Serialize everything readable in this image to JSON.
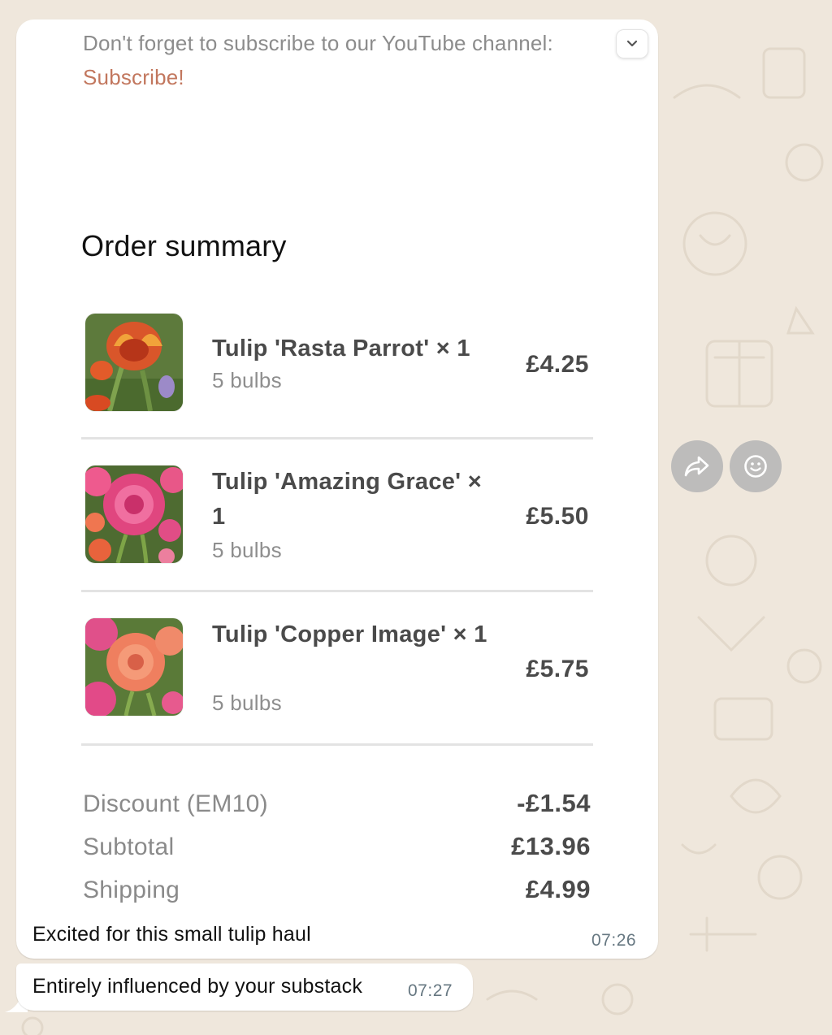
{
  "chat": {
    "message": {
      "preview_text": "Don't forget to subscribe to our YouTube channel:",
      "preview_link": "Subscribe!",
      "order_title": "Order summary",
      "items": [
        {
          "name": "Tulip 'Rasta Parrot' × 1",
          "detail": "5 bulbs",
          "price": "£4.25",
          "image_icon": "tulip-photo-rasta-parrot"
        },
        {
          "name": "Tulip 'Amazing Grace' × 1",
          "detail": "5 bulbs",
          "price": "£5.50",
          "image_icon": "tulip-photo-amazing-grace"
        },
        {
          "name": "Tulip 'Copper Image' × 1",
          "detail": "5 bulbs",
          "price": "£5.75",
          "image_icon": "tulip-photo-copper-image"
        }
      ],
      "summary": {
        "discount_label": "Discount (EM10)",
        "discount_value": "-£1.54",
        "subtotal_label": "Subtotal",
        "subtotal_value": "£13.96",
        "shipping_label": "Shipping",
        "shipping_value": "£4.99"
      },
      "caption": "Excited for this small tulip haul",
      "time": "07:26"
    },
    "second_message": {
      "text": "Entirely influenced by your substack",
      "time": "07:27"
    },
    "actions": {
      "forward_icon": "forward-arrow-icon",
      "react_icon": "smiley-icon"
    },
    "colors": {
      "wallpaper": "#efe7dc",
      "bubble": "#ffffff",
      "link": "#c2775e",
      "action_button": "#bdbcbb"
    }
  }
}
